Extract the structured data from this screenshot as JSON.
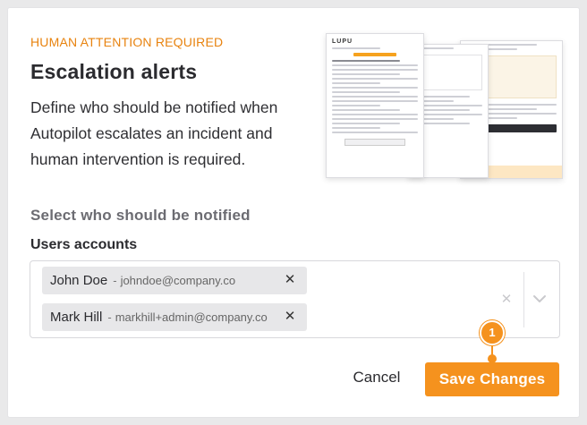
{
  "header": {
    "kicker": "HUMAN ATTENTION REQUIRED",
    "title": "Escalation alerts",
    "description": "Define who should be notified when Autopilot escalates an incident and human intervention is required."
  },
  "preview": {
    "logo": "LUPU"
  },
  "section": {
    "title": "Select who should be notified",
    "field_label": "Users accounts"
  },
  "selected_users": [
    {
      "name": "John Doe",
      "separator": "-",
      "email": "johndoe@company.co"
    },
    {
      "name": "Mark Hill",
      "separator": "-",
      "email": "markhill+admin@company.co"
    }
  ],
  "icons": {
    "remove": "close-icon",
    "clear": "clear-icon",
    "dropdown": "chevron-down-icon"
  },
  "actions": {
    "cancel_label": "Cancel",
    "save_label": "Save Changes"
  },
  "step_marker": {
    "number": "1"
  },
  "colors": {
    "accent": "#f5921e",
    "kicker": "#e8830f"
  }
}
